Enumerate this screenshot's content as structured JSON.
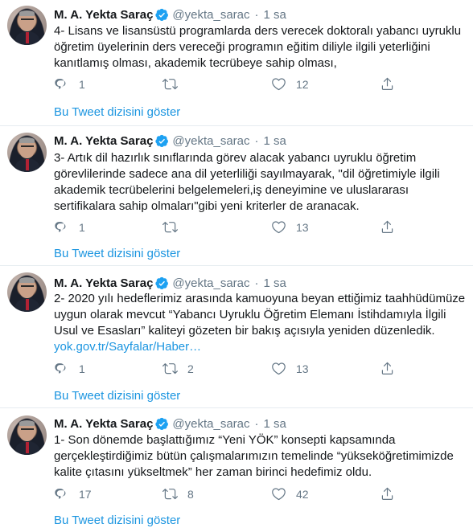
{
  "tweets": [
    {
      "name": "M. A. Yekta Saraç",
      "handle": "@yekta_sarac",
      "time": "1 sa",
      "lines": [
        "4- Lisans ve lisansüstü programlarda ders verecek doktoralı yabancı uyruklu",
        "öğretim üyelerinin ders vereceği programın eğitim diliyle ilgili yeterliğini",
        "kanıtlamış olması, akademik tecrübeye sahip olması,"
      ],
      "link": "",
      "reply_count": "1",
      "retweet_count": "",
      "like_count": "12",
      "thread_label": "Bu Tweet dizisini göster"
    },
    {
      "name": "M. A. Yekta Saraç",
      "handle": "@yekta_sarac",
      "time": "1 sa",
      "lines": [
        "3- Artık dil hazırlık sınıflarında görev alacak yabancı uyruklu öğretim",
        "görevlilerinde sadece ana dil yeterliliği sayılmayarak, \"dil öğretimiyle ilgili",
        "akademik tecrübelerini belgelemeleri,iş deneyimine ve uluslararası",
        "sertifikalara sahip olmaları\"gibi yeni kriterler de aranacak."
      ],
      "link": "",
      "reply_count": "1",
      "retweet_count": "",
      "like_count": "13",
      "thread_label": "Bu Tweet dizisini göster"
    },
    {
      "name": "M. A. Yekta Saraç",
      "handle": "@yekta_sarac",
      "time": "1 sa",
      "lines": [
        "2- 2020 yılı hedeflerimiz arasında kamuoyuna beyan ettiğimiz taahhüdümüze",
        "uygun olarak mevcut “Yabancı Uyruklu Öğretim Elemanı İstihdamıyla İlgili",
        "Usul ve Esasları” kaliteyi gözeten bir bakış açısıyla yeniden düzenledik."
      ],
      "link": "yok.gov.tr/Sayfalar/Haber…",
      "reply_count": "1",
      "retweet_count": "2",
      "like_count": "13",
      "thread_label": "Bu Tweet dizisini göster"
    },
    {
      "name": "M. A. Yekta Saraç",
      "handle": "@yekta_sarac",
      "time": "1 sa",
      "lines": [
        "1- Son dönemde başlattığımız “Yeni YÖK” konsepti kapsamında",
        "gerçekleştirdiğimiz bütün çalışmalarımızın temelinde “yükseköğretimimizde",
        "kalite çıtasını yükseltmek” her zaman birinci hedefimiz oldu."
      ],
      "link": "",
      "reply_count": "17",
      "retweet_count": "8",
      "like_count": "42",
      "thread_label": "Bu Tweet dizisini göster"
    }
  ],
  "icons": {
    "reply": "reply-icon",
    "retweet": "retweet-icon",
    "like": "heart-icon",
    "share": "share-icon",
    "verified": "verified-badge-icon"
  },
  "colors": {
    "accent": "#1b95e0",
    "verified": "#1da1f2",
    "muted": "#657786",
    "text": "#14171a",
    "divider": "#e6ecf0"
  }
}
